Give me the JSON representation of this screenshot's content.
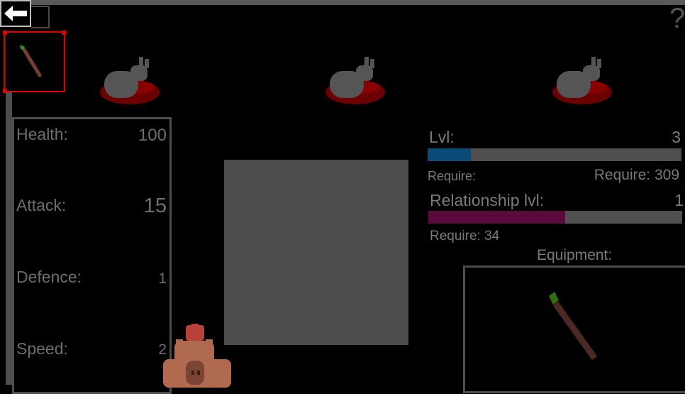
{
  "colors": {
    "background": "#000000",
    "panel": "#4d4d4d",
    "text": "#7a7a7a",
    "level_fill": "#0a4a78",
    "relationship_fill": "#5c0a3e",
    "selection": "#e00000"
  },
  "header": {
    "back_icon": "arrow-left-icon",
    "help_label": "?"
  },
  "inventory": {
    "selected_item_icon": "carrot-icon"
  },
  "enemies": [
    {
      "icon": "rabbit-icon"
    },
    {
      "icon": "rabbit-icon"
    },
    {
      "icon": "rabbit-icon"
    }
  ],
  "stats": {
    "health_label": "Health:",
    "health_value": "100",
    "attack_label": "Attack:",
    "attack_value": "15",
    "defence_label": "Defence:",
    "defence_value": "1",
    "speed_label": "Speed:",
    "speed_value": "2"
  },
  "level": {
    "label": "Lvl:",
    "value": "3",
    "require_left": "Require:",
    "require_right": "Require: 309",
    "progress": 0.17
  },
  "relationship": {
    "label": "Relationship lvl:",
    "value": "1",
    "require": "Require: 34",
    "progress": 0.54
  },
  "equipment": {
    "label": "Equipment:",
    "item_icon": "carrot-icon"
  },
  "character": {
    "icon": "capybara-icon"
  }
}
